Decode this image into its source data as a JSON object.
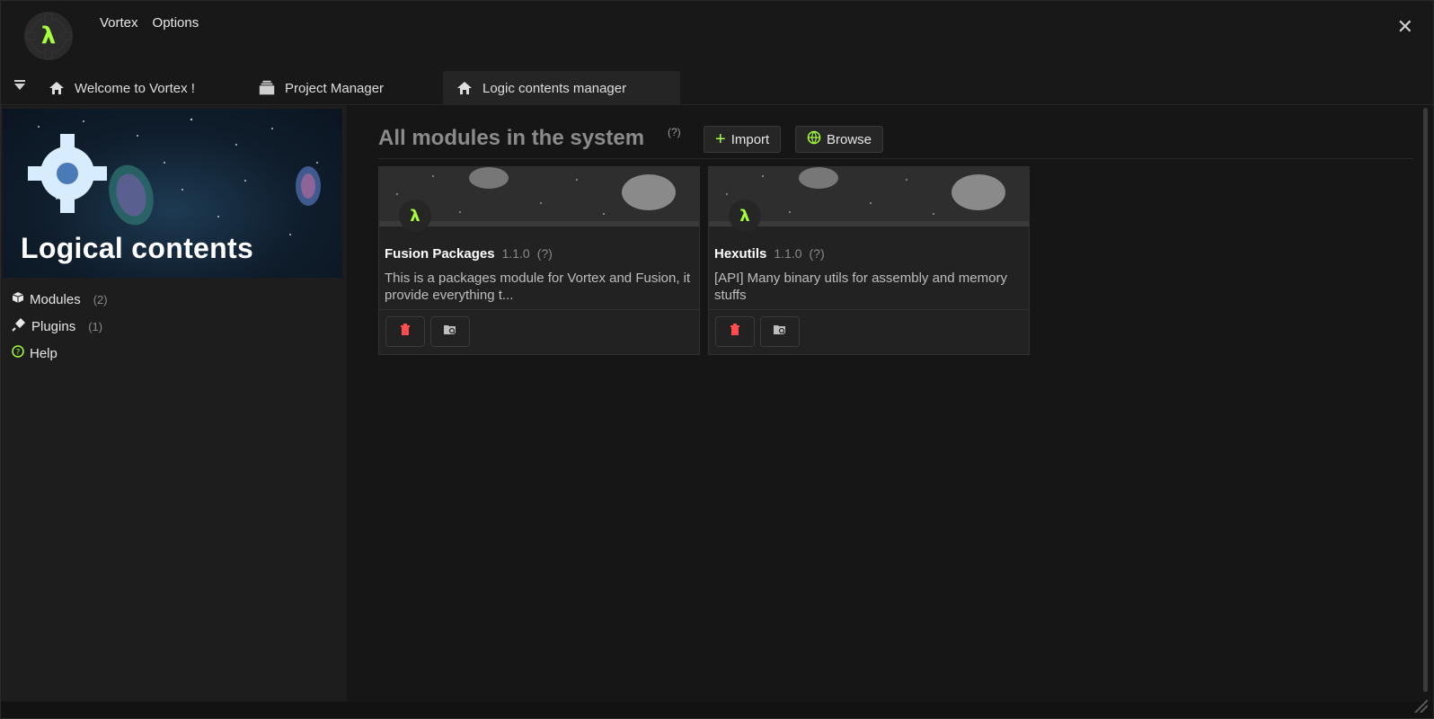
{
  "app": {
    "logo_glyph": "λ",
    "menu": [
      "Vortex",
      "Options"
    ]
  },
  "tabs": [
    {
      "label": "Welcome to Vortex !",
      "icon": "home-icon"
    },
    {
      "label": "Project Manager",
      "icon": "project-stack-icon"
    },
    {
      "label": "Logic contents manager",
      "icon": "home-icon",
      "active": true
    }
  ],
  "sidebar": {
    "banner_title": "Logical contents",
    "items": [
      {
        "label": "Modules",
        "count": "(2)",
        "icon": "cube-icon"
      },
      {
        "label": "Plugins",
        "count": "(1)",
        "icon": "plug-icon"
      },
      {
        "label": "Help",
        "count": "",
        "icon": "help-circle-icon"
      }
    ]
  },
  "main": {
    "heading": "All modules in the system",
    "heading_help": "(?)",
    "import_label": "Import",
    "browse_label": "Browse",
    "cards": [
      {
        "name": "Fusion Packages",
        "version": "1.1.0",
        "help": "(?)",
        "description": "This is a packages module for Vortex and Fusion, it provide everything t..."
      },
      {
        "name": "Hexutils",
        "version": "1.1.0",
        "help": "(?)",
        "description": "[API] Many binary utils for assembly and memory stuffs"
      }
    ]
  },
  "colors": {
    "accent": "#a6ff3b",
    "danger": "#ff4d4d",
    "background": "#161616"
  }
}
